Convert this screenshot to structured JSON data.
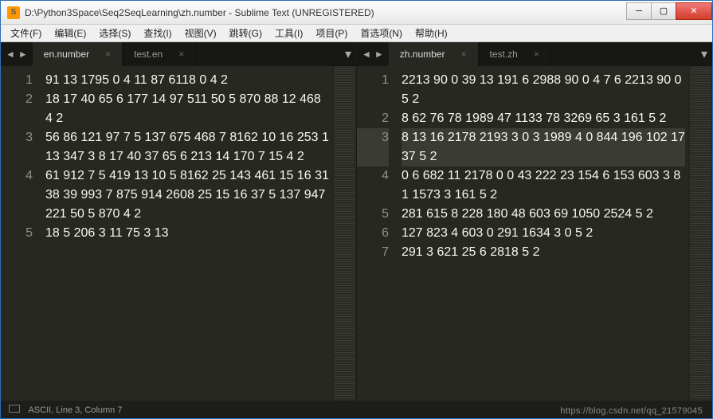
{
  "titlebar": {
    "path": "D:\\Python3Space\\Seq2SeqLearning\\zh.number - Sublime Text (UNREGISTERED)"
  },
  "menu": {
    "file": "文件(F)",
    "edit": "编辑(E)",
    "select": "选择(S)",
    "find": "查找(I)",
    "view": "视图(V)",
    "goto": "跳转(G)",
    "tools": "工具(I)",
    "project": "项目(P)",
    "prefs": "首选项(N)",
    "help": "帮助(H)"
  },
  "left": {
    "tab_active": "en.number",
    "tab_other": "test.en",
    "line_numbers": [
      "1",
      "2",
      "3",
      "4",
      "5"
    ],
    "lines": [
      "91 13 1795 0 4 11 87 6118 0 4 2",
      "18 17 40 65 6 177 14 97 511 50 5 870 88 12 468 4 2",
      "56 86 121 97 7 5 137 675 468 7 8162 10 16 253 113 347 3 8 17 40 37 65 6 213 14 170 7 15 4 2",
      "61 912 7 5 419 13 10 5 8162 25 143 461 15 16 3138 39 993 7 875 914 2608 25 15 16 37 5 137 947 221 50 5 870 4 2",
      "18 5 206 3 11 75 3 13"
    ]
  },
  "right": {
    "tab_active": "zh.number",
    "tab_other": "test.zh",
    "line_numbers": [
      "1",
      "2",
      "3",
      "4",
      "5",
      "6",
      "7"
    ],
    "lines": [
      "2213 90 0 39 13 191 6 2988 90 0 4 7 6 2213 90 0 5 2",
      "8 62 76 78 1989 47 1133 78 3269 65 3 161 5 2",
      "8 13 16 2178 2193 3 0 3 1989 4 0 844 196 102 17 37 5 2",
      "0 6 682 11 2178 0 0 43 222 23 154 6 153 603 3 81 1573 3 161 5 2",
      "281 615 8 228 180 48 603 69 1050 2524 5 2",
      "127 823 4 603 0 291 1634 3 0 5 2",
      "291 3 621 25 6 2818 5 2"
    ],
    "active_line_index": 2
  },
  "status": {
    "left": "ASCII, Line 3, Column 7"
  },
  "watermark": "https://blog.csdn.net/qq_21579045"
}
